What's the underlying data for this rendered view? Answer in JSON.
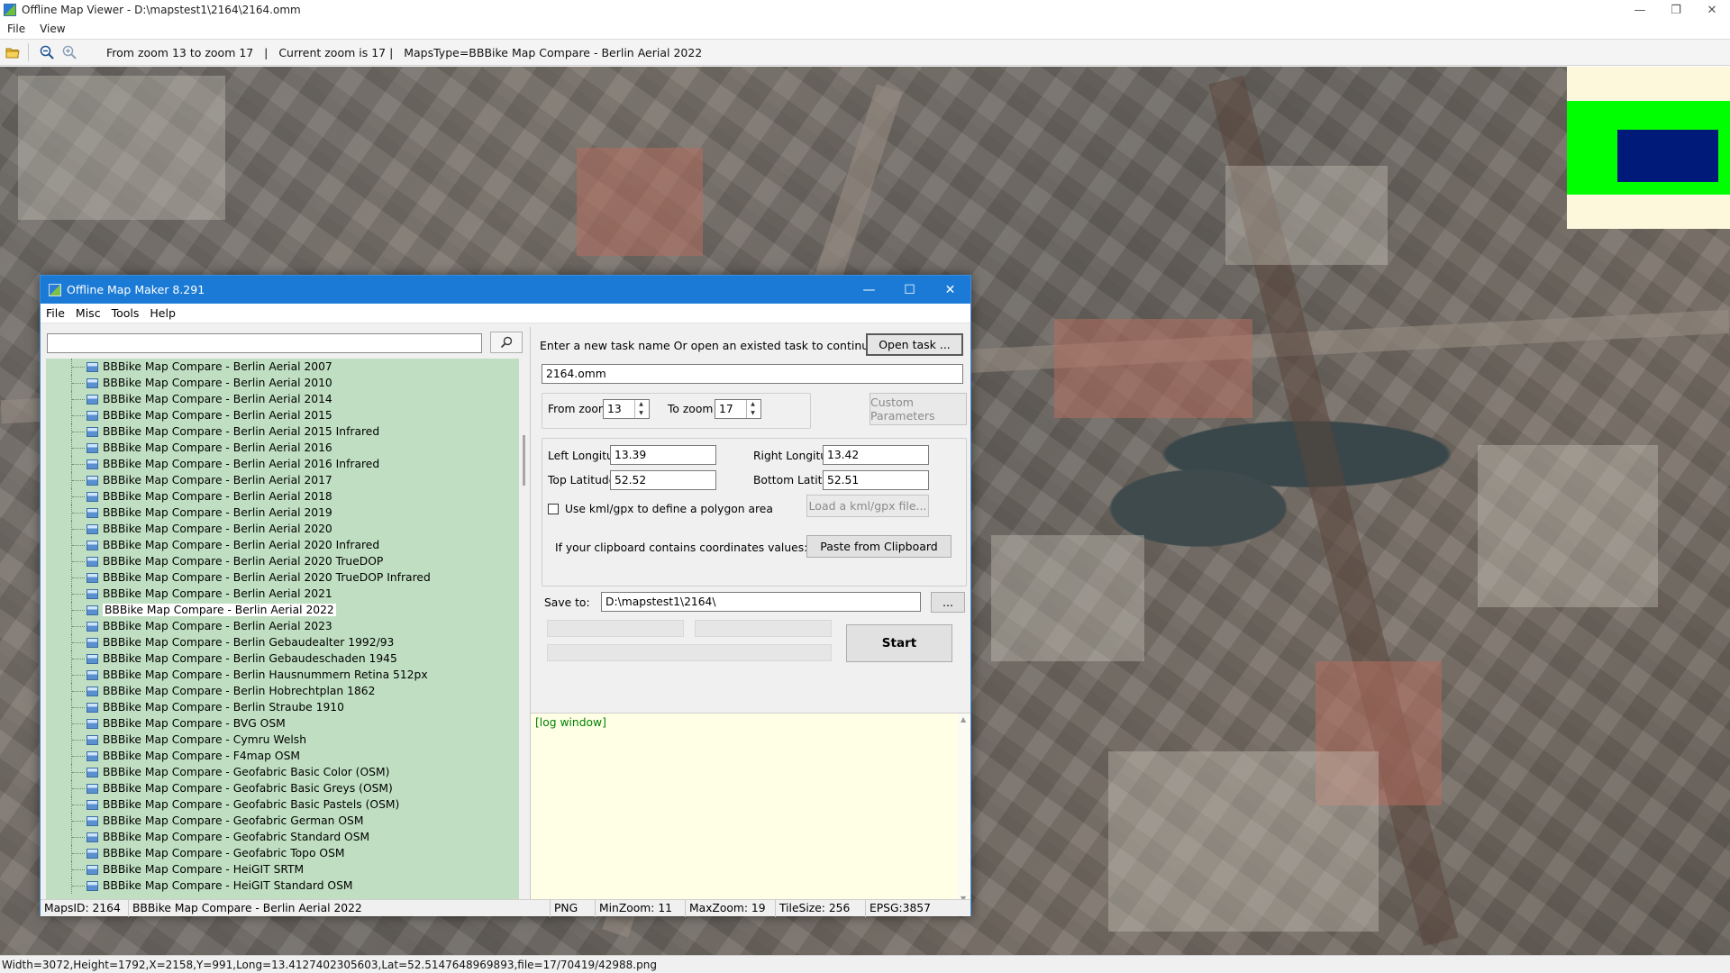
{
  "window": {
    "title": "Offline Map Viewer - D:\\mapstest1\\2164\\2164.omm",
    "controls": {
      "minimize": "—",
      "restore": "❐",
      "close": "✕"
    }
  },
  "menu": [
    "File",
    "View"
  ],
  "toolbar": {
    "info": "From zoom 13 to zoom 17   |   Current zoom is 17 |   MapsType=BBBike Map Compare - Berlin Aerial 2022",
    "icons": [
      "open-folder-icon",
      "zoom-out-icon",
      "zoom-in-icon"
    ]
  },
  "statusbar": {
    "text": "Width=3072,Height=1792,X=2158,Y=991,Long=13.4127402305603,Lat=52.5147648969893,file=17/70419/42988.png"
  },
  "dialog": {
    "title": "Offline Map Maker 8.291",
    "controls": {
      "minimize": "—",
      "maximize": "☐",
      "close": "✕"
    },
    "menu": [
      "File",
      "Misc",
      "Tools",
      "Help"
    ],
    "search": {
      "value": "",
      "placeholder": ""
    },
    "tree_items": [
      "BBBike Map Compare - Berlin Aerial 2007",
      "BBBike Map Compare - Berlin Aerial 2010",
      "BBBike Map Compare - Berlin Aerial 2014",
      "BBBike Map Compare - Berlin Aerial 2015",
      "BBBike Map Compare - Berlin Aerial 2015 Infrared",
      "BBBike Map Compare - Berlin Aerial 2016",
      "BBBike Map Compare - Berlin Aerial 2016 Infrared",
      "BBBike Map Compare - Berlin Aerial 2017",
      "BBBike Map Compare - Berlin Aerial 2018",
      "BBBike Map Compare - Berlin Aerial 2019",
      "BBBike Map Compare - Berlin Aerial 2020",
      "BBBike Map Compare - Berlin Aerial 2020 Infrared",
      "BBBike Map Compare - Berlin Aerial 2020 TrueDOP",
      "BBBike Map Compare - Berlin Aerial 2020 TrueDOP Infrared",
      "BBBike Map Compare - Berlin Aerial 2021",
      "BBBike Map Compare - Berlin Aerial 2022",
      "BBBike Map Compare - Berlin Aerial 2023",
      "BBBike Map Compare - Berlin Gebaudealter 1992/93",
      "BBBike Map Compare - Berlin Gebaudeschaden 1945",
      "BBBike Map Compare - Berlin Hausnummern Retina 512px",
      "BBBike Map Compare - Berlin Hobrechtplan 1862",
      "BBBike Map Compare - Berlin Straube 1910",
      "BBBike Map Compare - BVG OSM",
      "BBBike Map Compare - Cymru Welsh",
      "BBBike Map Compare - F4map OSM",
      "BBBike Map Compare - Geofabric Basic Color (OSM)",
      "BBBike Map Compare - Geofabric Basic Greys (OSM)",
      "BBBike Map Compare - Geofabric Basic Pastels (OSM)",
      "BBBike Map Compare - Geofabric German OSM",
      "BBBike Map Compare - Geofabric Standard OSM",
      "BBBike Map Compare - Geofabric Topo OSM",
      "BBBike Map Compare - HeiGIT SRTM",
      "BBBike Map Compare - HeiGIT Standard OSM"
    ],
    "selected_item": "BBBike Map Compare - Berlin Aerial 2022",
    "task_label": "Enter a new task name Or open an existed task to continue:",
    "open_task_btn": "Open task ...",
    "task_name": "2164.omm",
    "from_zoom_label": "From zoom",
    "from_zoom": "13",
    "to_zoom_label": "To zoom",
    "to_zoom": "17",
    "custom_params_btn": "Custom Parameters",
    "left_lon_label": "Left Longitude",
    "left_lon": "13.39",
    "right_lon_label": "Right Longitude",
    "right_lon": "13.42",
    "top_lat_label": "Top Latitude",
    "top_lat": "52.52",
    "bottom_lat_label": "Bottom Latitude",
    "bottom_lat": "52.51",
    "kml_check_label": "Use kml/gpx to define a polygon area",
    "kml_checked": false,
    "load_kml_btn": "Load a kml/gpx file...",
    "clipboard_label": "If your clipboard contains coordinates values:",
    "paste_btn": "Paste from Clipboard",
    "save_label": "Save to:",
    "save_path": "D:\\mapstest1\\2164\\",
    "browse_btn": "...",
    "start_btn": "Start",
    "progress": [
      0,
      0,
      0
    ],
    "log_text": "[log window]",
    "status": {
      "maps_id": "MapsID: 2164",
      "maps_name": "BBBike Map Compare - Berlin Aerial 2022",
      "format": "PNG",
      "min_zoom": "MinZoom: 11",
      "max_zoom": "MaxZoom: 19",
      "tile_size": "TileSize: 256",
      "epsg": "EPSG:3857"
    }
  },
  "colors": {
    "dialog_titlebar": "#1a7ad6",
    "tree_bg": "#c0dfc2",
    "log_bg": "#ffffe6",
    "overview_bg": "#fdf8dc",
    "overview_green": "#00ff00",
    "overview_view": "#001a7a"
  }
}
